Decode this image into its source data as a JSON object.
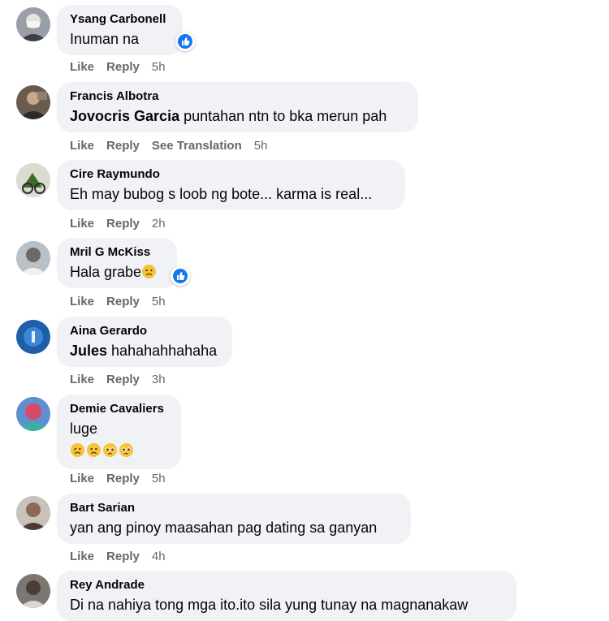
{
  "comments": [
    {
      "author": "Ysang Carbonell",
      "text": "Inuman na",
      "actions": {
        "like": "Like",
        "reply": "Reply",
        "time": "5h"
      }
    },
    {
      "author": "Francis Albotra",
      "mention": "Jovocris Garcia",
      "text": "puntahan ntn to bka merun pah",
      "actions": {
        "like": "Like",
        "reply": "Reply",
        "translate": "See Translation",
        "time": "5h"
      }
    },
    {
      "author": "Cire Raymundo",
      "text": "Eh may bubog s loob ng bote... karma is real...",
      "actions": {
        "like": "Like",
        "reply": "Reply",
        "time": "2h"
      }
    },
    {
      "author": "Mril G McKiss",
      "text": "Hala grabe",
      "actions": {
        "like": "Like",
        "reply": "Reply",
        "time": "5h"
      }
    },
    {
      "author": "Aina Gerardo",
      "mention": "Jules",
      "text": "hahahahhahaha",
      "actions": {
        "like": "Like",
        "reply": "Reply",
        "time": "3h"
      }
    },
    {
      "author": "Demie Cavaliers",
      "text": "luge",
      "actions": {
        "like": "Like",
        "reply": "Reply",
        "time": "5h"
      }
    },
    {
      "author": "Bart Sarian",
      "text": "yan ang pinoy maasahan pag dating sa ganyan",
      "actions": {
        "like": "Like",
        "reply": "Reply",
        "time": "4h"
      }
    },
    {
      "author": "Rey Andrade",
      "text": "Di na nahiya tong mga ito.ito sila yung tunay na magnanakaw"
    }
  ],
  "icons": {
    "like_badge": "thumbs-up-icon",
    "sad_emoji": "sad-face-icon",
    "pleading_emoji": "pleading-face-icon"
  },
  "colors": {
    "bubble": "#f0f2f5",
    "like_blue": "#1877f2",
    "secondary_text": "#65676b"
  }
}
